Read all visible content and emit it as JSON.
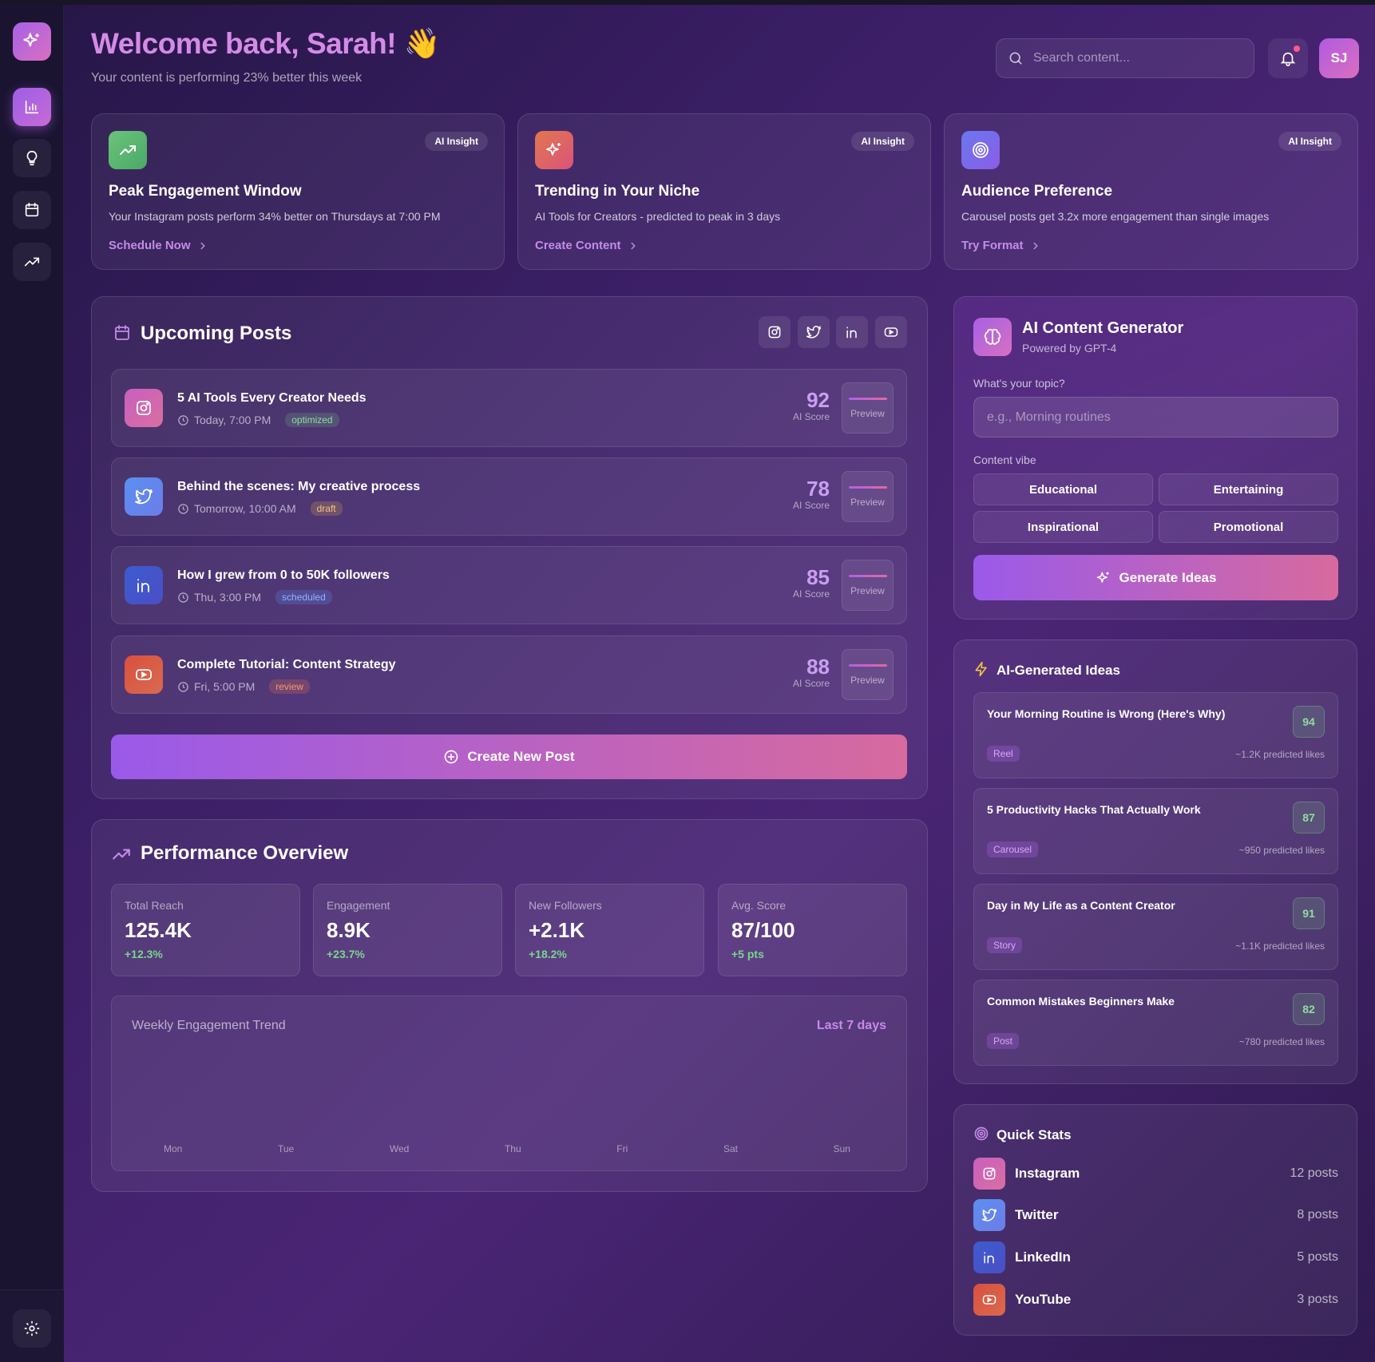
{
  "header": {
    "welcome": "Welcome back, Sarah! 👋",
    "subtitle": "Your content is performing 23% better this week",
    "search_placeholder": "Search content...",
    "avatar_initials": "SJ"
  },
  "insights": [
    {
      "badge": "AI Insight",
      "title": "Peak Engagement Window",
      "text": "Your Instagram posts perform 34% better on Thursdays at 7:00 PM",
      "link": "Schedule Now",
      "icon": "trending-up-icon"
    },
    {
      "badge": "AI Insight",
      "title": "Trending in Your Niche",
      "text": "AI Tools for Creators - predicted to peak in 3 days",
      "link": "Create Content",
      "icon": "sparkles-icon"
    },
    {
      "badge": "AI Insight",
      "title": "Audience Preference",
      "text": "Carousel posts get 3.2x more engagement than single images",
      "link": "Try Format",
      "icon": "target-icon"
    }
  ],
  "upcoming": {
    "title": "Upcoming Posts",
    "posts": [
      {
        "title": "5 AI Tools Every Creator Needs",
        "time": "Today, 7:00 PM",
        "status": "optimized",
        "score": "92",
        "score_label": "AI Score",
        "preview": "Preview",
        "platform": "instagram"
      },
      {
        "title": "Behind the scenes: My creative process",
        "time": "Tomorrow, 10:00 AM",
        "status": "draft",
        "score": "78",
        "score_label": "AI Score",
        "preview": "Preview",
        "platform": "twitter"
      },
      {
        "title": "How I grew from 0 to 50K followers",
        "time": "Thu, 3:00 PM",
        "status": "scheduled",
        "score": "85",
        "score_label": "AI Score",
        "preview": "Preview",
        "platform": "linkedin"
      },
      {
        "title": "Complete Tutorial: Content Strategy",
        "time": "Fri, 5:00 PM",
        "status": "review",
        "score": "88",
        "score_label": "AI Score",
        "preview": "Preview",
        "platform": "youtube"
      }
    ],
    "create_button": "Create New Post"
  },
  "performance": {
    "title": "Performance Overview",
    "stats": [
      {
        "label": "Total Reach",
        "value": "125.4K",
        "change": "+12.3%"
      },
      {
        "label": "Engagement",
        "value": "8.9K",
        "change": "+23.7%"
      },
      {
        "label": "New Followers",
        "value": "+2.1K",
        "change": "+18.2%"
      },
      {
        "label": "Avg. Score",
        "value": "87/100",
        "change": "+5 pts"
      }
    ],
    "trend_title": "Weekly Engagement Trend",
    "trend_range": "Last 7 days",
    "days": [
      "Mon",
      "Tue",
      "Wed",
      "Thu",
      "Fri",
      "Sat",
      "Sun"
    ]
  },
  "generator": {
    "title": "AI Content Generator",
    "subtitle": "Powered by GPT-4",
    "topic_label": "What's your topic?",
    "topic_placeholder": "e.g., Morning routines",
    "vibe_label": "Content vibe",
    "vibes": [
      "Educational",
      "Entertaining",
      "Inspirational",
      "Promotional"
    ],
    "button": "Generate Ideas"
  },
  "ideas": {
    "title": "AI-Generated Ideas",
    "items": [
      {
        "title": "Your Morning Routine is Wrong (Here's Why)",
        "score": "94",
        "type": "Reel",
        "predicted": "~1.2K predicted likes"
      },
      {
        "title": "5 Productivity Hacks That Actually Work",
        "score": "87",
        "type": "Carousel",
        "predicted": "~950 predicted likes"
      },
      {
        "title": "Day in My Life as a Content Creator",
        "score": "91",
        "type": "Story",
        "predicted": "~1.1K predicted likes"
      },
      {
        "title": "Common Mistakes Beginners Make",
        "score": "82",
        "type": "Post",
        "predicted": "~780 predicted likes"
      }
    ]
  },
  "quick_stats": {
    "title": "Quick Stats",
    "items": [
      {
        "name": "Instagram",
        "count": "12 posts"
      },
      {
        "name": "Twitter",
        "count": "8 posts"
      },
      {
        "name": "LinkedIn",
        "count": "5 posts"
      },
      {
        "name": "YouTube",
        "count": "3 posts"
      }
    ]
  },
  "colors": {
    "accent": "#c58be8",
    "instagram": "#c95fc0",
    "twitter": "#5b8ff0",
    "linkedin": "#3d5bd0",
    "youtube": "#d9503f",
    "positive": "#79d68b"
  }
}
